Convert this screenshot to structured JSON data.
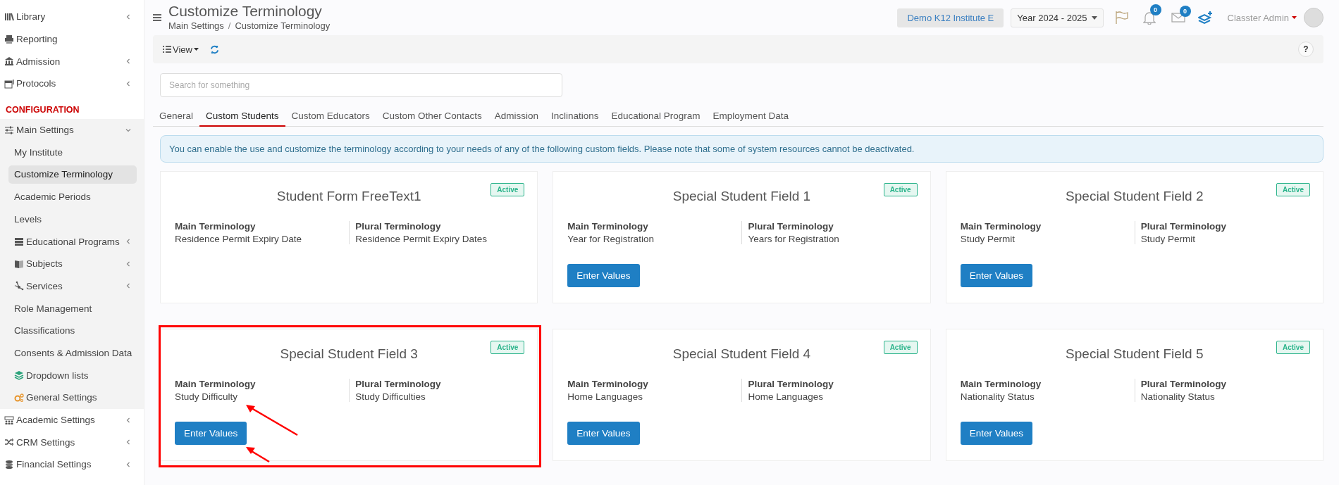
{
  "sidebar": {
    "items": [
      {
        "label": "Library",
        "expanded": false,
        "selected": false
      },
      {
        "label": "Reporting",
        "selected": false
      },
      {
        "label": "Admission",
        "expanded": false,
        "selected": false
      },
      {
        "label": "Protocols",
        "expanded": false,
        "selected": false
      }
    ],
    "section_title": "CONFIGURATION",
    "config_items": [
      {
        "label": "Main Settings",
        "expanded": true,
        "selected": false,
        "children": [
          {
            "label": "My Institute",
            "selected": false
          },
          {
            "label": "Customize Terminology",
            "selected": true
          },
          {
            "label": "Academic Periods",
            "selected": false
          },
          {
            "label": "Levels",
            "selected": false
          },
          {
            "label": "Educational Programs",
            "expanded": false,
            "selected": false
          },
          {
            "label": "Subjects",
            "expanded": false,
            "selected": false
          },
          {
            "label": "Services",
            "expanded": false,
            "selected": false
          },
          {
            "label": "Role Management",
            "selected": false
          },
          {
            "label": "Classifications",
            "selected": false
          },
          {
            "label": "Consents & Admission Data",
            "selected": false
          },
          {
            "label": "Dropdown lists",
            "selected": false
          },
          {
            "label": "General Settings",
            "selected": false
          }
        ]
      },
      {
        "label": "Academic Settings",
        "expanded": false,
        "selected": false
      },
      {
        "label": "CRM Settings",
        "expanded": false,
        "selected": false
      },
      {
        "label": "Financial Settings",
        "expanded": false,
        "selected": false
      }
    ]
  },
  "header": {
    "title": "Customize Terminology",
    "breadcrumb": [
      "Main Settings",
      "Customize Terminology"
    ],
    "breadcrumb_separator": "/",
    "institute": "Demo K12 Institute E",
    "year": "Year 2024 - 2025",
    "notifications": "0",
    "messages": "0",
    "user": "Classter Admin"
  },
  "toolbar": {
    "view": "View",
    "help": "?"
  },
  "search": {
    "placeholder": "Search for something"
  },
  "tabs": [
    {
      "label": "General",
      "selected": false
    },
    {
      "label": "Custom Students",
      "selected": true
    },
    {
      "label": "Custom Educators",
      "selected": false
    },
    {
      "label": "Custom Other Contacts",
      "selected": false
    },
    {
      "label": "Admission",
      "selected": false
    },
    {
      "label": "Inclinations",
      "selected": false
    },
    {
      "label": "Educational Program",
      "selected": false
    },
    {
      "label": "Employment Data",
      "selected": false
    }
  ],
  "info": "You can enable the use and customize the terminology according to your needs of any of the following custom fields. Please note that some of system resources cannot be deactivated.",
  "cards": [
    {
      "title": "Student Form FreeText1",
      "status": "Active",
      "main_label": "Main Terminology",
      "main": "Residence Permit Expiry Date",
      "plural_label": "Plural Terminology",
      "plural": "Residence Permit Expiry Dates",
      "highlighted": false
    },
    {
      "title": "Special Student Field 1",
      "status": "Active",
      "main_label": "Main Terminology",
      "main": "Year for Registration",
      "plural_label": "Plural Terminology",
      "plural": "Years for Registration",
      "button": "Enter Values",
      "highlighted": false
    },
    {
      "title": "Special Student Field 2",
      "status": "Active",
      "main_label": "Main Terminology",
      "main": "Study Permit",
      "plural_label": "Plural Terminology",
      "plural": "Study Permit",
      "button": "Enter Values",
      "highlighted": false
    },
    {
      "title": "Special Student Field 3",
      "status": "Active",
      "main_label": "Main Terminology",
      "main": "Study Difficulty",
      "plural_label": "Plural Terminology",
      "plural": "Study Difficulties",
      "button": "Enter Values",
      "highlighted": true
    },
    {
      "title": "Special Student Field 4",
      "status": "Active",
      "main_label": "Main Terminology",
      "main": "Home Languages",
      "plural_label": "Plural Terminology",
      "plural": "Home Languages",
      "button": "Enter Values",
      "highlighted": false
    },
    {
      "title": "Special Student Field 5",
      "status": "Active",
      "main_label": "Main Terminology",
      "main": "Nationality Status",
      "plural_label": "Plural Terminology",
      "plural": "Nationality Status",
      "button": "Enter Values",
      "highlighted": false
    }
  ]
}
